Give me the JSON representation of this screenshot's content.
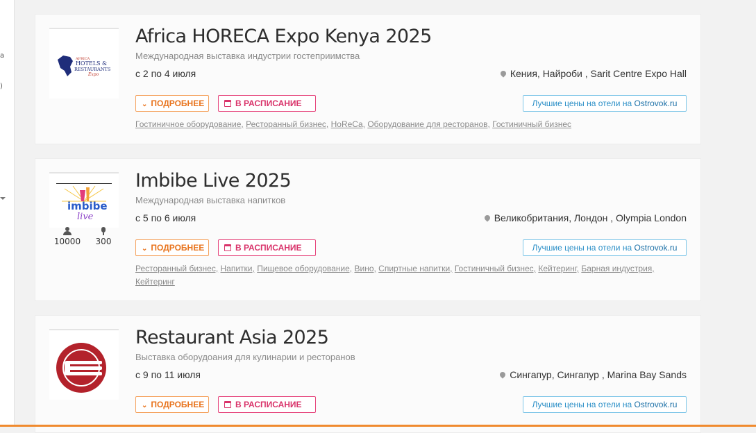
{
  "events": [
    {
      "title": "Africa HORECA Expo Kenya 2025",
      "subtitle": "Международная выставка индустрии гостеприимства",
      "dates": "с 2 по 4 июля",
      "location": "Кения, Найроби , Sarit Centre Expo Hall",
      "logo_lines": [
        "AFRICA",
        "HOTELS &",
        "RESTAURANTS",
        "Expo"
      ],
      "tags": [
        "Гостиничное оборудование,",
        "Ресторанный бизнес,",
        "HoReCa,",
        "Оборудование для ресторанов,",
        "Гостиничный бизнес"
      ]
    },
    {
      "title": "Imbibe Live 2025",
      "subtitle": "Международная выставка напитков",
      "dates": "с 5 по 6 июля",
      "location": "Великобритания, Лондон , Olympia London",
      "logo_lines": [
        "imbibe",
        "live"
      ],
      "stats": {
        "visitors": "10000",
        "exhibitors": "300"
      },
      "tags": [
        "Ресторанный бизнес,",
        "Напитки,",
        "Пищевое оборудование,",
        "Вино,",
        "Спиртные напитки,",
        "Гостиничный бизнес,",
        "Кейтеринг,",
        "Барная индустрия,",
        "Кейтеринг"
      ]
    },
    {
      "title": "Restaurant Asia 2025",
      "subtitle": "Выставка оборудоания для кулинарии и ресторанов",
      "dates": "с 9 по 11 июля",
      "location": "Сингапур, Сингапур , Marina Bay Sands"
    }
  ],
  "buttons": {
    "more": "ПОДРОБНЕЕ",
    "schedule": "В РАСПИСАНИЕ",
    "hotel_prefix": "Лучшие цены на отели на ",
    "hotel_brand": "Ostrovok.ru"
  },
  "icons": {
    "location": "map-pin-icon",
    "more": "chevron-down-icon",
    "schedule": "calendar-icon",
    "visitors": "user-icon",
    "exhibitors": "microphone-icon"
  },
  "colors": {
    "more_button": "#e8731c",
    "schedule_button": "#d9336a",
    "hotel_button": "#2b8fc7",
    "africa_logo": "#1f2d7a",
    "restaurant_asia_logo": "#b3222b"
  }
}
